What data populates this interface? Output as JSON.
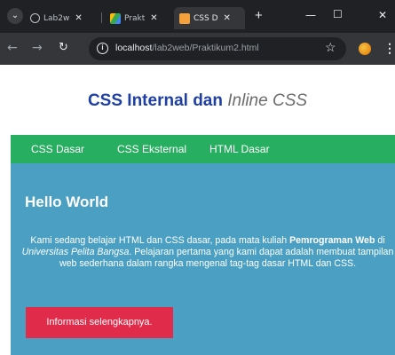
{
  "browser": {
    "tabs": [
      {
        "title": "Lab2w",
        "favicon": "github-icon",
        "active": false
      },
      {
        "title": "Prakt",
        "favicon": "drive-icon",
        "active": false
      },
      {
        "title": "CSS D",
        "favicon": "html-icon",
        "active": true
      }
    ],
    "tab_close_glyph": "✕",
    "new_tab_glyph": "+",
    "url_host": "localhost",
    "url_path": "/lab2web/Praktikum2.html",
    "colors": {
      "tabstrip": "#202124",
      "toolbar": "#35363a",
      "omnibox": "#202124"
    }
  },
  "page": {
    "title_main": "CSS Internal dan ",
    "title_italic": "Inline CSS",
    "nav_items": [
      "CSS Dasar",
      "CSS Eksternal",
      "HTML Dasar"
    ],
    "hero": {
      "title": "Hello World",
      "text_1": "Kami sedang belajar HTML dan CSS dasar, pada mata kuliah ",
      "text_bold": "Pemrograman Web",
      "text_2": " di ",
      "text_italic": "Universitas Pelita Bangsa",
      "text_3": ". Pelajaran pertama yang kami dapat adalah membuat tampilan web sederhana dalam rangka mengenal tag-tag dasar HTML dan CSS.",
      "button_label": "Informasi selengkapnya."
    },
    "colors": {
      "title": "#1f3fa3",
      "navbar": "#27ae60",
      "hero_bg": "#4a9fc3",
      "button": "#e02b4a"
    }
  }
}
